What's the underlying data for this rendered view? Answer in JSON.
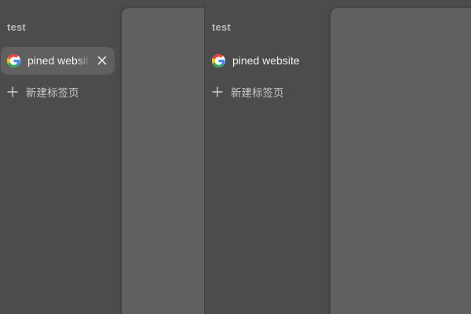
{
  "colors": {
    "background": "#4b4c4b",
    "content_panel": "#5f605f",
    "tab_hover": "#5f605f",
    "text_primary": "#eeeeee",
    "text_secondary": "#b9bab9"
  },
  "panes": [
    {
      "space_title": "test",
      "tab": {
        "label": "pined website",
        "favicon": "google-icon",
        "hovered": true,
        "close_icon": "close-icon"
      },
      "new_tab": {
        "icon": "plus-icon",
        "label": "新建标签页"
      }
    },
    {
      "space_title": "test",
      "tab": {
        "label": "pined website",
        "favicon": "google-icon",
        "hovered": false
      },
      "new_tab": {
        "icon": "plus-icon",
        "label": "新建标签页"
      }
    }
  ]
}
